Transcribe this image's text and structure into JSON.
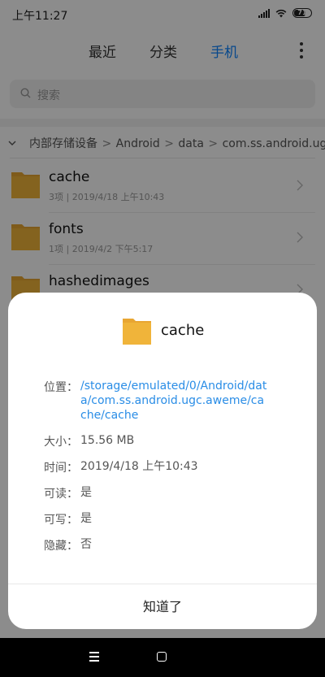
{
  "status_bar": {
    "time": "上午11:27",
    "battery": "71"
  },
  "tabs": [
    {
      "label": "最近",
      "active": false
    },
    {
      "label": "分类",
      "active": false
    },
    {
      "label": "手机",
      "active": true
    }
  ],
  "search": {
    "placeholder": "搜索"
  },
  "breadcrumb": {
    "items": [
      "内部存储设备",
      "Android",
      "data",
      "com.ss.android.ugc.aweme"
    ],
    "separator": ">"
  },
  "files": [
    {
      "name": "cache",
      "meta": "3项 | 2019/4/18 上午10:43"
    },
    {
      "name": "fonts",
      "meta": "1项 | 2019/4/2 下午5:17"
    },
    {
      "name": "hashedimages",
      "meta": ""
    }
  ],
  "dialog": {
    "title": "cache",
    "location_label": "位置：",
    "location_value": "/storage/emulated/0/Android/data/com.ss.android.ugc.aweme/cache/cache",
    "size_label": "大小：",
    "size_value": "15.56 MB",
    "time_label": "时间：",
    "time_value": "2019/4/18 上午10:43",
    "readable_label": "可读：",
    "readable_value": "是",
    "writable_label": "可写：",
    "writable_value": "是",
    "hidden_label": "隐藏：",
    "hidden_value": "否",
    "ok_label": "知道了"
  },
  "colors": {
    "accent": "#0d84ff",
    "link": "#2a8de6",
    "folder": "#f0b43a"
  },
  "icons": [
    "signal-icon",
    "wifi-icon",
    "battery-icon",
    "more-icon",
    "search-icon",
    "chevron-down-icon",
    "folder-icon",
    "chevron-right-icon",
    "menu-icon",
    "home-icon"
  ]
}
